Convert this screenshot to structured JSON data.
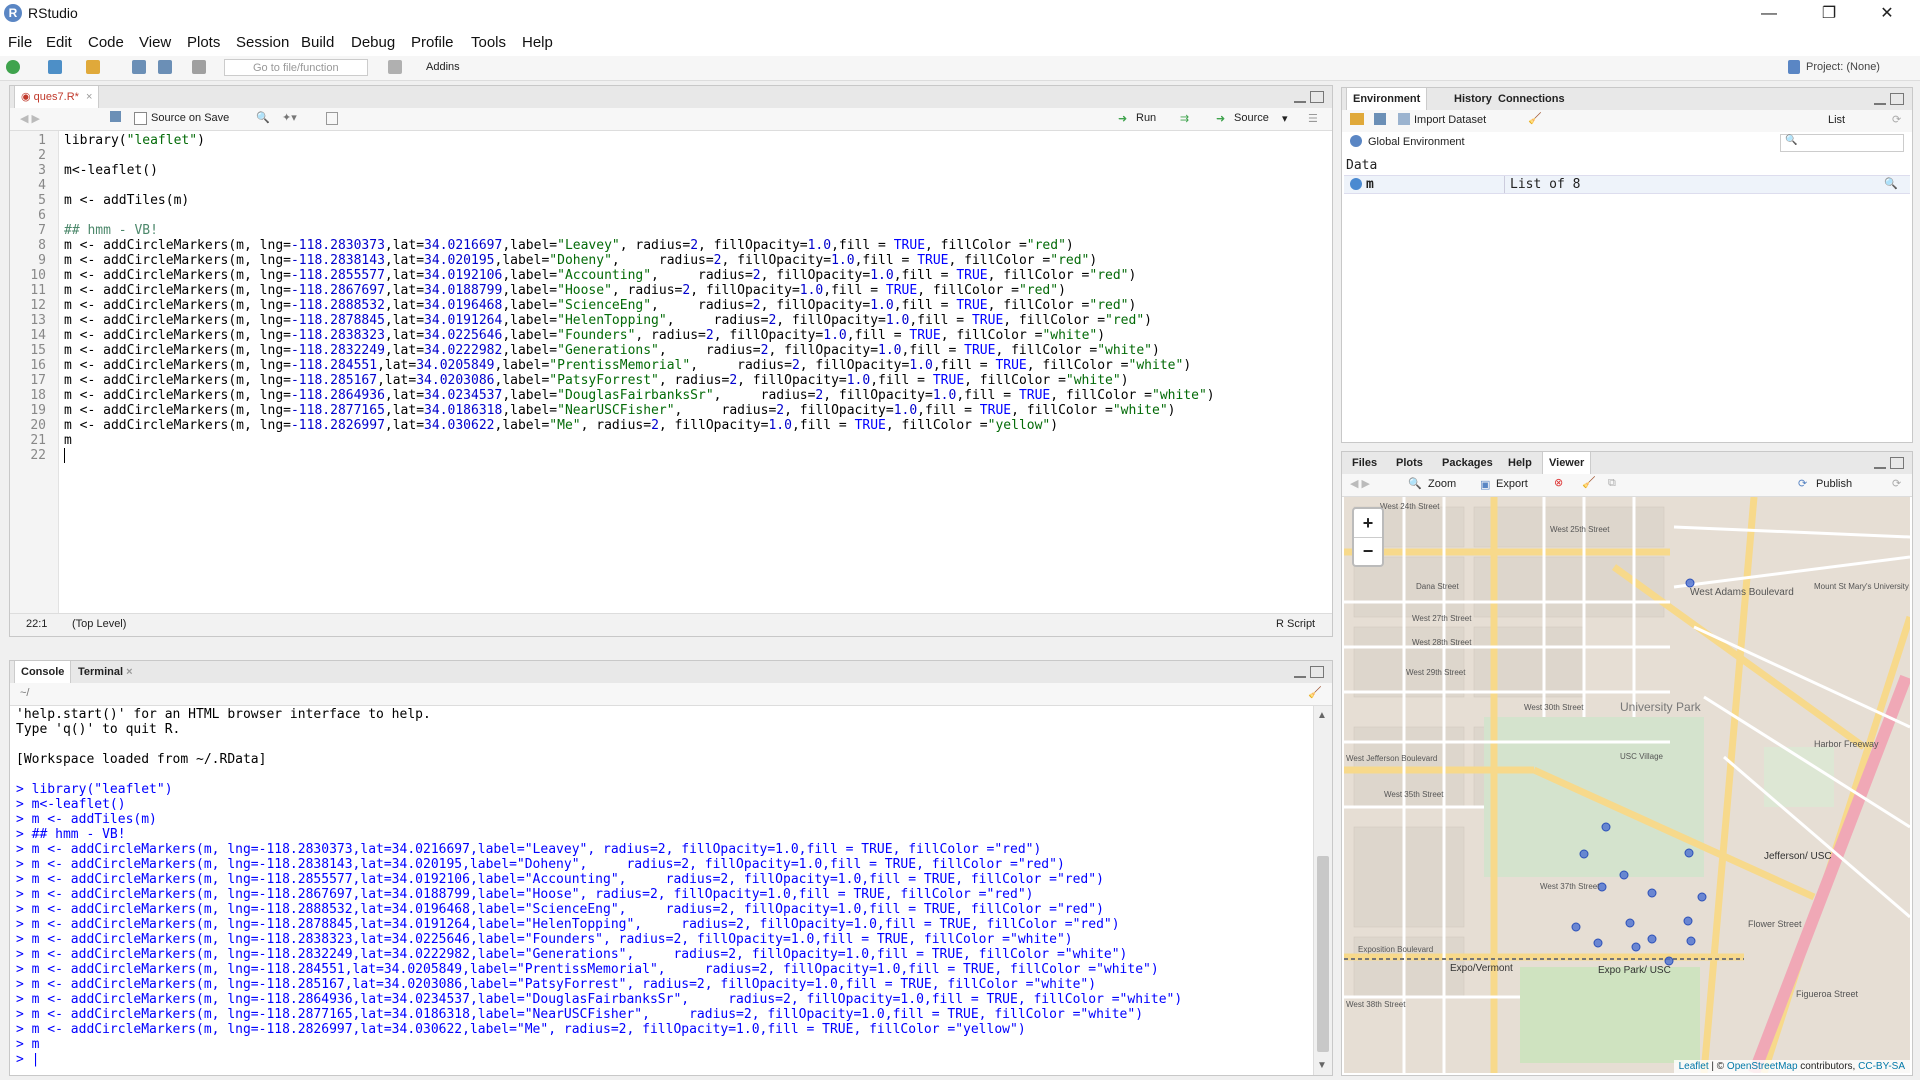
{
  "window": {
    "title": "RStudio",
    "app_icon": "R"
  },
  "menu": [
    "File",
    "Edit",
    "Code",
    "View",
    "Plots",
    "Session",
    "Build",
    "Debug",
    "Profile",
    "Tools",
    "Help"
  ],
  "toolbar": {
    "goto_placeholder": "Go to file/function",
    "addins": "Addins",
    "project": "Project: (None)"
  },
  "editor": {
    "tab": "ques7.R*",
    "source_on_save": "Source on Save",
    "run": "Run",
    "source": "Source",
    "cursor_pos": "22:1",
    "scope": "(Top Level)",
    "filetype": "R Script",
    "lines": [
      "library(\"leaflet\")",
      "",
      "m<-leaflet()",
      "",
      "m <- addTiles(m)",
      "",
      "## hmm - VB!",
      "m <- addCircleMarkers(m, lng=-118.2830373,lat=34.0216697,label=\"Leavey\", radius=2, fillOpacity=1.0,fill = TRUE, fillColor =\"red\")",
      "m <- addCircleMarkers(m, lng=-118.2838143,lat=34.020195,label=\"Doheny\",     radius=2, fillOpacity=1.0,fill = TRUE, fillColor =\"red\")",
      "m <- addCircleMarkers(m, lng=-118.2855577,lat=34.0192106,label=\"Accounting\",     radius=2, fillOpacity=1.0,fill = TRUE, fillColor =\"red\")",
      "m <- addCircleMarkers(m, lng=-118.2867697,lat=34.0188799,label=\"Hoose\", radius=2, fillOpacity=1.0,fill = TRUE, fillColor =\"red\")",
      "m <- addCircleMarkers(m, lng=-118.2888532,lat=34.0196468,label=\"ScienceEng\",     radius=2, fillOpacity=1.0,fill = TRUE, fillColor =\"red\")",
      "m <- addCircleMarkers(m, lng=-118.2878845,lat=34.0191264,label=\"HelenTopping\",     radius=2, fillOpacity=1.0,fill = TRUE, fillColor =\"red\")",
      "m <- addCircleMarkers(m, lng=-118.2838323,lat=34.0225646,label=\"Founders\", radius=2, fillOpacity=1.0,fill = TRUE, fillColor =\"white\")",
      "m <- addCircleMarkers(m, lng=-118.2832249,lat=34.0222982,label=\"Generations\",     radius=2, fillOpacity=1.0,fill = TRUE, fillColor =\"white\")",
      "m <- addCircleMarkers(m, lng=-118.284551,lat=34.0205849,label=\"PrentissMemorial\",     radius=2, fillOpacity=1.0,fill = TRUE, fillColor =\"white\")",
      "m <- addCircleMarkers(m, lng=-118.285167,lat=34.0203086,label=\"PatsyForrest\", radius=2, fillOpacity=1.0,fill = TRUE, fillColor =\"white\")",
      "m <- addCircleMarkers(m, lng=-118.2864936,lat=34.0234537,label=\"DouglasFairbanksSr\",     radius=2, fillOpacity=1.0,fill = TRUE, fillColor =\"white\")",
      "m <- addCircleMarkers(m, lng=-118.2877165,lat=34.0186318,label=\"NearUSCFisher\",     radius=2, fillOpacity=1.0,fill = TRUE, fillColor =\"white\")",
      "m <- addCircleMarkers(m, lng=-118.2826997,lat=34.030622,label=\"Me\", radius=2, fillOpacity=1.0,fill = TRUE, fillColor =\"yellow\")",
      "m",
      ""
    ]
  },
  "console": {
    "tabs": [
      "Console",
      "Terminal"
    ],
    "path": "~/",
    "lines": [
      {
        "t": "'help.start()' for an HTML browser interface to help.",
        "c": "out"
      },
      {
        "t": "Type 'q()' to quit R.",
        "c": "out"
      },
      {
        "t": "",
        "c": "out"
      },
      {
        "t": "[Workspace loaded from ~/.RData]",
        "c": "out"
      },
      {
        "t": "",
        "c": "out"
      },
      {
        "t": "> library(\"leaflet\")",
        "c": "cmd"
      },
      {
        "t": "> m<-leaflet()",
        "c": "cmd"
      },
      {
        "t": "> m <- addTiles(m)",
        "c": "cmd"
      },
      {
        "t": "> ## hmm - VB!",
        "c": "cmd"
      },
      {
        "t": "> m <- addCircleMarkers(m, lng=-118.2830373,lat=34.0216697,label=\"Leavey\", radius=2, fillOpacity=1.0,fill = TRUE, fillColor =\"red\")",
        "c": "cmd"
      },
      {
        "t": "> m <- addCircleMarkers(m, lng=-118.2838143,lat=34.020195,label=\"Doheny\",     radius=2, fillOpacity=1.0,fill = TRUE, fillColor =\"red\")",
        "c": "cmd"
      },
      {
        "t": "> m <- addCircleMarkers(m, lng=-118.2855577,lat=34.0192106,label=\"Accounting\",     radius=2, fillOpacity=1.0,fill = TRUE, fillColor =\"red\")",
        "c": "cmd"
      },
      {
        "t": "> m <- addCircleMarkers(m, lng=-118.2867697,lat=34.0188799,label=\"Hoose\", radius=2, fillOpacity=1.0,fill = TRUE, fillColor =\"red\")",
        "c": "cmd"
      },
      {
        "t": "> m <- addCircleMarkers(m, lng=-118.2888532,lat=34.0196468,label=\"ScienceEng\",     radius=2, fillOpacity=1.0,fill = TRUE, fillColor =\"red\")",
        "c": "cmd"
      },
      {
        "t": "> m <- addCircleMarkers(m, lng=-118.2878845,lat=34.0191264,label=\"HelenTopping\",     radius=2, fillOpacity=1.0,fill = TRUE, fillColor =\"red\")",
        "c": "cmd"
      },
      {
        "t": "> m <- addCircleMarkers(m, lng=-118.2838323,lat=34.0225646,label=\"Founders\", radius=2, fillOpacity=1.0,fill = TRUE, fillColor =\"white\")",
        "c": "cmd"
      },
      {
        "t": "> m <- addCircleMarkers(m, lng=-118.2832249,lat=34.0222982,label=\"Generations\",     radius=2, fillOpacity=1.0,fill = TRUE, fillColor =\"white\")",
        "c": "cmd"
      },
      {
        "t": "> m <- addCircleMarkers(m, lng=-118.284551,lat=34.0205849,label=\"PrentissMemorial\",     radius=2, fillOpacity=1.0,fill = TRUE, fillColor =\"white\")",
        "c": "cmd"
      },
      {
        "t": "> m <- addCircleMarkers(m, lng=-118.285167,lat=34.0203086,label=\"PatsyForrest\", radius=2, fillOpacity=1.0,fill = TRUE, fillColor =\"white\")",
        "c": "cmd"
      },
      {
        "t": "> m <- addCircleMarkers(m, lng=-118.2864936,lat=34.0234537,label=\"DouglasFairbanksSr\",     radius=2, fillOpacity=1.0,fill = TRUE, fillColor =\"white\")",
        "c": "cmd"
      },
      {
        "t": "> m <- addCircleMarkers(m, lng=-118.2877165,lat=34.0186318,label=\"NearUSCFisher\",     radius=2, fillOpacity=1.0,fill = TRUE, fillColor =\"white\")",
        "c": "cmd"
      },
      {
        "t": "> m <- addCircleMarkers(m, lng=-118.2826997,lat=34.030622,label=\"Me\", radius=2, fillOpacity=1.0,fill = TRUE, fillColor =\"yellow\")",
        "c": "cmd"
      },
      {
        "t": "> m",
        "c": "cmd"
      },
      {
        "t": "> |",
        "c": "cmd"
      }
    ]
  },
  "environment": {
    "tabs": [
      "Environment",
      "History",
      "Connections"
    ],
    "import_dataset": "Import Dataset",
    "list_view": "List",
    "scope": "Global Environment",
    "section": "Data",
    "rows": [
      {
        "name": "m",
        "value": "List of 8"
      }
    ]
  },
  "viewer": {
    "tabs": [
      "Files",
      "Plots",
      "Packages",
      "Help",
      "Viewer"
    ],
    "zoom": "Zoom",
    "export": "Export",
    "publish": "Publish",
    "zoom_in": "+",
    "zoom_out": "−",
    "attribution": {
      "leaflet": "Leaflet",
      "sep": " | © ",
      "osm": "OpenStreetMap",
      "contrib": " contributors, ",
      "license": "CC-BY-SA"
    },
    "labels": [
      "West 24th Street",
      "West 25th Street",
      "Dana Street",
      "West 27th Street",
      "West 28th Street",
      "West 29th Street",
      "West 30th Street",
      "University Park",
      "West Adams Boulevard",
      "West Jefferson Boulevard",
      "USC Village",
      "West 35th Street",
      "Jefferson/ USC",
      "Exposition Boulevard",
      "Expo/Vermont",
      "Expo Park/ USC",
      "West 37th Street",
      "West 38th Street",
      "Mount St Mary's University Doheny Campus",
      "Harbor Freeway",
      "Flower Street",
      "Figueroa Street"
    ]
  }
}
